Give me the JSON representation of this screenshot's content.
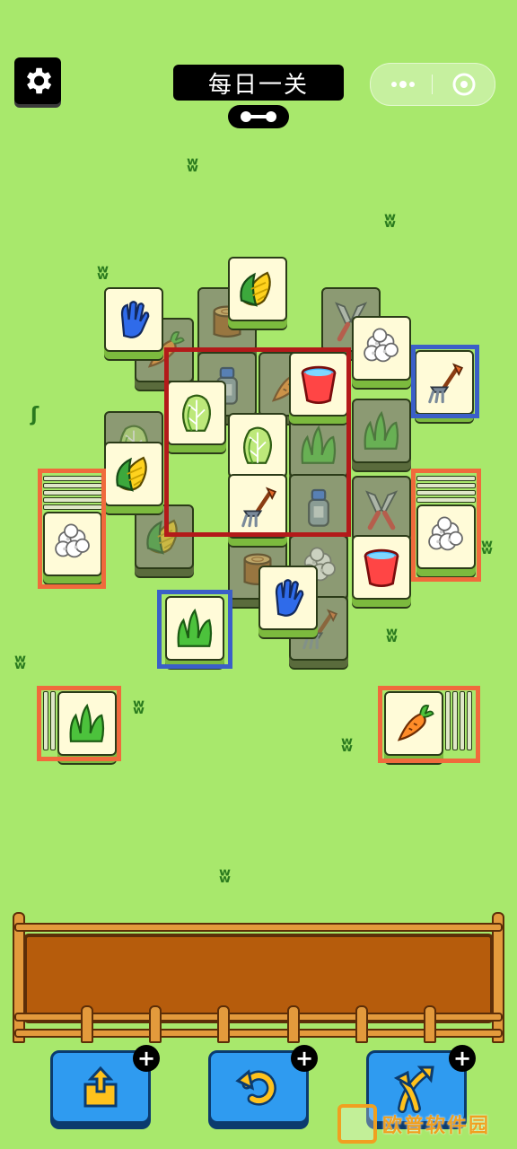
{
  "header": {
    "title": "每日一关",
    "settings_icon": "gear-icon",
    "capsule": {
      "more_icon": "more-dots-icon",
      "close_icon": "target-close-icon"
    }
  },
  "tiles": {
    "glove": "blue-glove",
    "corn": "corn",
    "cauliflower": "cauliflower",
    "fork": "garden-fork",
    "bucket": "red-bucket",
    "cabbage": "napa-cabbage",
    "grass": "grass-tuft",
    "carrot": "carrot",
    "stump": "tree-stump",
    "shears": "pruning-shears",
    "spray": "spray-bottle"
  },
  "highlight_colors": {
    "red": "#b31a1a",
    "blue": "#3b5fc8",
    "orange": "#f06a3c"
  },
  "colors": {
    "background": "#a8e86c",
    "tray": "#b65c0c",
    "button": "#2f9bf0"
  },
  "tray": {
    "slots_filled": 0
  },
  "buttons": {
    "remove": {
      "icon": "move-out-icon",
      "plus": "+"
    },
    "undo": {
      "icon": "undo-icon",
      "plus": "+"
    },
    "shuffle": {
      "icon": "shuffle-icon",
      "plus": "+"
    }
  },
  "watermark": {
    "text": "欧普软件园"
  }
}
